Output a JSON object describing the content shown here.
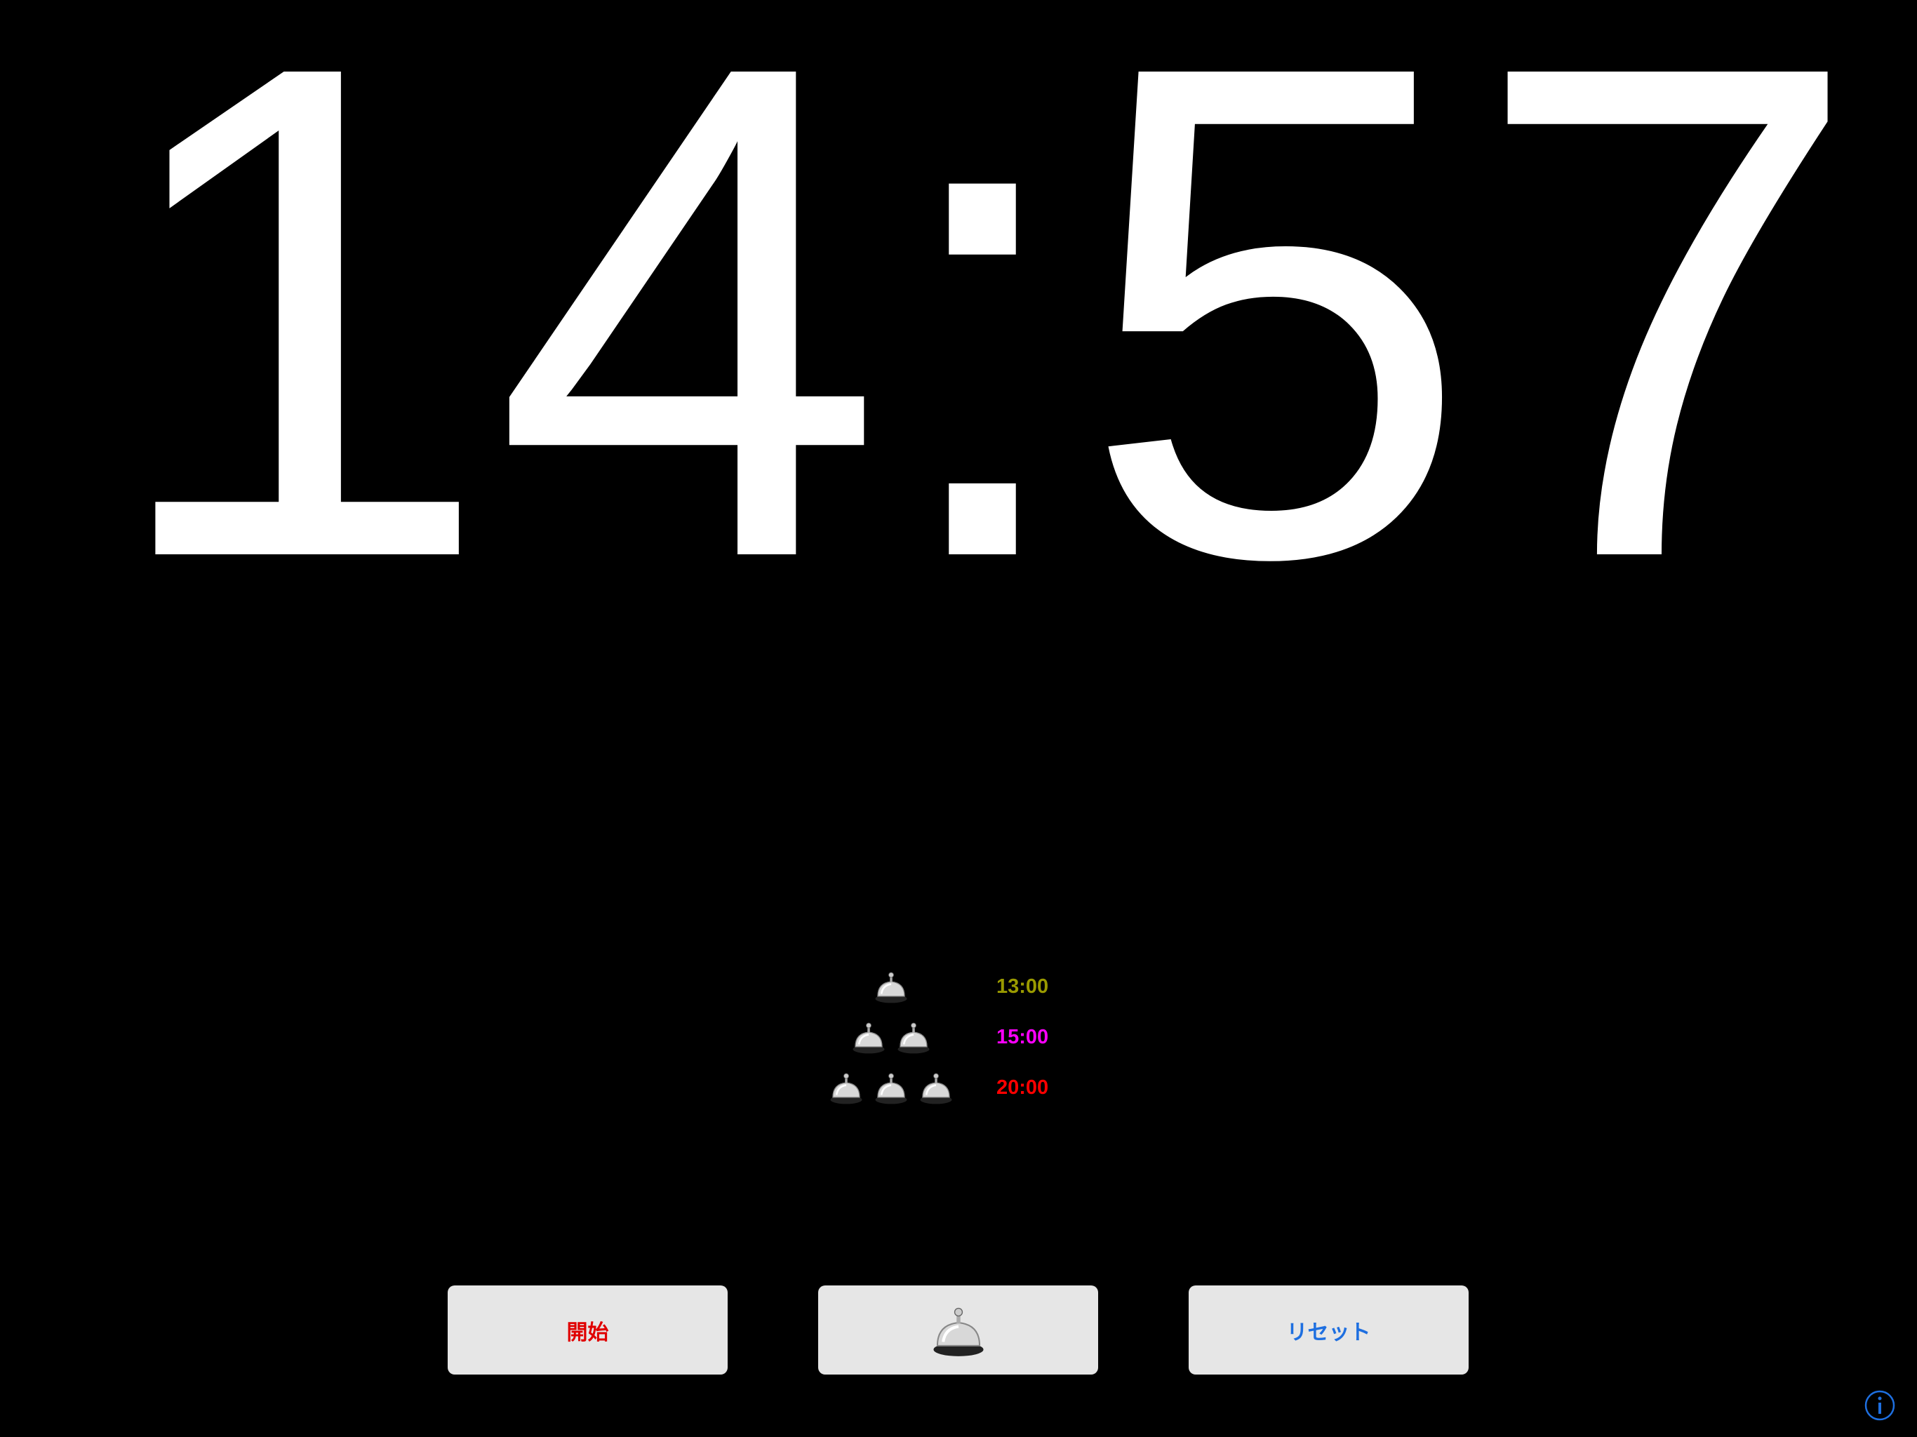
{
  "timer": {
    "display": "14:57"
  },
  "bell_schedule": [
    {
      "bell_count": 1,
      "time": "13:00",
      "color": "#9a9a00"
    },
    {
      "bell_count": 2,
      "time": "15:00",
      "color": "#ff00ff"
    },
    {
      "bell_count": 3,
      "time": "20:00",
      "color": "#ff0000"
    }
  ],
  "controls": {
    "start_label": "開始",
    "start_color": "#e00000",
    "bell_button_icon": "bell-icon",
    "reset_label": "リセット",
    "reset_color": "#1e6fe0"
  },
  "info_icon": "info-icon"
}
